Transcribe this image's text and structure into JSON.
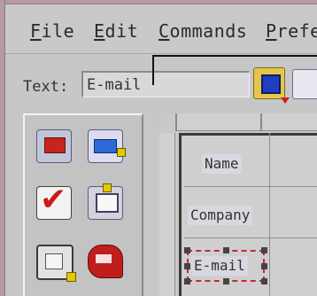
{
  "menubar": {
    "items": [
      {
        "label": "File",
        "mnemonic": "F",
        "rest": "ile"
      },
      {
        "label": "Edit",
        "mnemonic": "E",
        "rest": "dit"
      },
      {
        "label": "Commands",
        "mnemonic": "C",
        "rest": "ommands"
      },
      {
        "label": "Prefe",
        "mnemonic": "P",
        "rest": "refe"
      }
    ]
  },
  "text_field": {
    "label": "Text:",
    "value": "E-mail"
  },
  "toolbar": {
    "icons": [
      "color-picker-icon",
      "next-icon"
    ]
  },
  "palette": {
    "icons": [
      "label-icon",
      "textfield-icon",
      "checkbox-icon",
      "panel-icon",
      "image-icon",
      "shape-icon"
    ]
  },
  "form_table": {
    "rows": [
      {
        "label": "Name"
      },
      {
        "label": "Company"
      },
      {
        "label": "E-mail"
      }
    ]
  },
  "colors": {
    "accent": "#c3263a",
    "window_border": "#b59aa6",
    "background": "#c7c7c7"
  }
}
